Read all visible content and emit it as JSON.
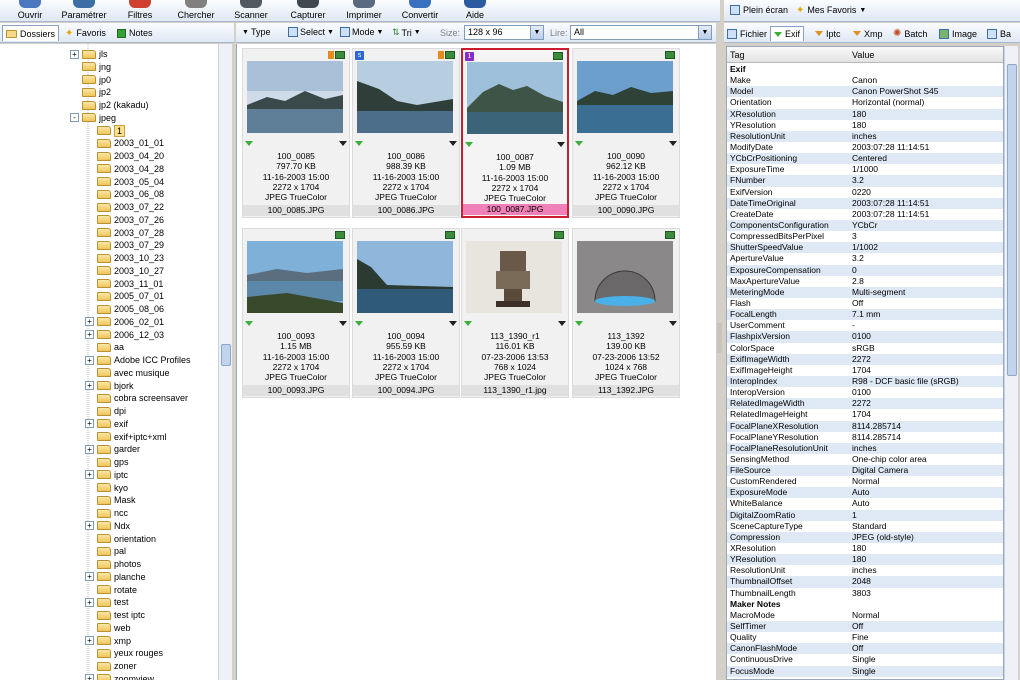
{
  "toolbar": {
    "items": [
      {
        "label": "Ouvrir",
        "icon": "open-icon",
        "color": "#4a78c0"
      },
      {
        "label": "Paramétrer",
        "icon": "settings-icon",
        "color": "#3a6ea5"
      },
      {
        "label": "Filtres",
        "icon": "filters-icon",
        "color": "#d04030"
      },
      {
        "label": "Chercher",
        "icon": "search-icon",
        "color": "#808080"
      },
      {
        "label": "Scanner",
        "icon": "scanner-icon",
        "color": "#505860"
      },
      {
        "label": "Capturer",
        "icon": "capture-icon",
        "color": "#404850"
      },
      {
        "label": "Imprimer",
        "icon": "print-icon",
        "color": "#5a6a80"
      },
      {
        "label": "Convertir",
        "icon": "convert-icon",
        "color": "#3a70c0"
      },
      {
        "label": "Aide",
        "icon": "help-icon",
        "color": "#2a5aa0"
      }
    ]
  },
  "right_toolbar": {
    "fullscreen_label": "Plein écran",
    "favorites_label": "Mes Favoris"
  },
  "left_tabs": {
    "folders": "Dossiers",
    "favorites": "Favoris",
    "notes": "Notes"
  },
  "tree": {
    "nodes": [
      {
        "label": "jls",
        "level": 1,
        "exp": "+"
      },
      {
        "label": "jng",
        "level": 1,
        "exp": ""
      },
      {
        "label": "jp0",
        "level": 1,
        "exp": ""
      },
      {
        "label": "jp2",
        "level": 1,
        "exp": ""
      },
      {
        "label": "jp2 (kakadu)",
        "level": 1,
        "exp": ""
      },
      {
        "label": "jpeg",
        "level": 1,
        "exp": "-"
      },
      {
        "label": "1",
        "level": 2,
        "exp": "",
        "selected": true
      },
      {
        "label": "2003_01_01",
        "level": 2,
        "exp": ""
      },
      {
        "label": "2003_04_20",
        "level": 2,
        "exp": ""
      },
      {
        "label": "2003_04_28",
        "level": 2,
        "exp": ""
      },
      {
        "label": "2003_05_04",
        "level": 2,
        "exp": ""
      },
      {
        "label": "2003_06_08",
        "level": 2,
        "exp": ""
      },
      {
        "label": "2003_07_22",
        "level": 2,
        "exp": ""
      },
      {
        "label": "2003_07_26",
        "level": 2,
        "exp": ""
      },
      {
        "label": "2003_07_28",
        "level": 2,
        "exp": ""
      },
      {
        "label": "2003_07_29",
        "level": 2,
        "exp": ""
      },
      {
        "label": "2003_10_23",
        "level": 2,
        "exp": ""
      },
      {
        "label": "2003_10_27",
        "level": 2,
        "exp": ""
      },
      {
        "label": "2003_11_01",
        "level": 2,
        "exp": ""
      },
      {
        "label": "2005_07_01",
        "level": 2,
        "exp": ""
      },
      {
        "label": "2005_08_06",
        "level": 2,
        "exp": ""
      },
      {
        "label": "2006_02_01",
        "level": 2,
        "exp": "+"
      },
      {
        "label": "2006_12_03",
        "level": 2,
        "exp": "+"
      },
      {
        "label": "aa",
        "level": 2,
        "exp": ""
      },
      {
        "label": "Adobe ICC Profiles",
        "level": 2,
        "exp": "+"
      },
      {
        "label": "avec musique",
        "level": 2,
        "exp": ""
      },
      {
        "label": "bjork",
        "level": 2,
        "exp": "+"
      },
      {
        "label": "cobra screensaver",
        "level": 2,
        "exp": ""
      },
      {
        "label": "dpi",
        "level": 2,
        "exp": ""
      },
      {
        "label": "exif",
        "level": 2,
        "exp": "+"
      },
      {
        "label": "exif+iptc+xml",
        "level": 2,
        "exp": ""
      },
      {
        "label": "garder",
        "level": 2,
        "exp": "+"
      },
      {
        "label": "gps",
        "level": 2,
        "exp": ""
      },
      {
        "label": "iptc",
        "level": 2,
        "exp": "+"
      },
      {
        "label": "kyo",
        "level": 2,
        "exp": ""
      },
      {
        "label": "Mask",
        "level": 2,
        "exp": ""
      },
      {
        "label": "ncc",
        "level": 2,
        "exp": ""
      },
      {
        "label": "Ndx",
        "level": 2,
        "exp": "+"
      },
      {
        "label": "orientation",
        "level": 2,
        "exp": ""
      },
      {
        "label": "pal",
        "level": 2,
        "exp": ""
      },
      {
        "label": "photos",
        "level": 2,
        "exp": ""
      },
      {
        "label": "planche",
        "level": 2,
        "exp": "+"
      },
      {
        "label": "rotate",
        "level": 2,
        "exp": ""
      },
      {
        "label": "test",
        "level": 2,
        "exp": "+"
      },
      {
        "label": "test iptc",
        "level": 2,
        "exp": ""
      },
      {
        "label": "web",
        "level": 2,
        "exp": ""
      },
      {
        "label": "xmp",
        "level": 2,
        "exp": "+"
      },
      {
        "label": "yeux rouges",
        "level": 2,
        "exp": ""
      },
      {
        "label": "zoner",
        "level": 2,
        "exp": ""
      },
      {
        "label": "zoomview",
        "level": 2,
        "exp": "+"
      }
    ]
  },
  "mid_toolbar": {
    "type_label": "Type",
    "select_label": "Select",
    "mode_label": "Mode",
    "sort_label": "Tri",
    "size_label": "Size:",
    "size_value": "128 x 96",
    "read_label": "Lire:",
    "read_value": "All"
  },
  "thumbnails": [
    {
      "name": "100_0085",
      "size": "797.70 KB",
      "date": "11-16-2003  15:00",
      "dims": "2272 x 1704",
      "format": "JPEG TrueColor",
      "file": "100_0085.JPG",
      "badge": "",
      "badge_color": "",
      "scene": "lake1"
    },
    {
      "name": "100_0086",
      "size": "988.39 KB",
      "date": "11-16-2003  15:00",
      "dims": "2272 x 1704",
      "format": "JPEG TrueColor",
      "file": "100_0086.JPG",
      "badge": "s",
      "badge_color": "#2a6ad0",
      "scene": "lake2"
    },
    {
      "name": "100_0087",
      "size": "1.09 MB",
      "date": "11-16-2003  15:00",
      "dims": "2272 x 1704",
      "format": "JPEG TrueColor",
      "file": "100_0087.JPG",
      "badge": "1",
      "badge_color": "#8a2ac8",
      "scene": "lake3",
      "selected": true
    },
    {
      "name": "100_0090",
      "size": "962.12 KB",
      "date": "11-16-2003  15:00",
      "dims": "2272 x 1704",
      "format": "JPEG TrueColor",
      "file": "100_0090.JPG",
      "badge": "",
      "badge_color": "",
      "scene": "lake4"
    },
    {
      "name": "100_0093",
      "size": "1.15 MB",
      "date": "11-16-2003  15:00",
      "dims": "2272 x 1704",
      "format": "JPEG TrueColor",
      "file": "100_0093.JPG",
      "badge": "",
      "badge_color": "",
      "scene": "lake5"
    },
    {
      "name": "100_0094",
      "size": "955.59 KB",
      "date": "11-16-2003  15:00",
      "dims": "2272 x 1704",
      "format": "JPEG TrueColor",
      "file": "100_0094.JPG",
      "badge": "",
      "badge_color": "",
      "scene": "lake6"
    },
    {
      "name": "113_1390_r1",
      "size": "116.01 KB",
      "date": "07-23-2006  13:53",
      "dims": "768 x 1024",
      "format": "JPEG TrueColor",
      "file": "113_1390_r1.jpg",
      "badge": "",
      "badge_color": "",
      "scene": "statue"
    },
    {
      "name": "113_1392",
      "size": "139.00 KB",
      "date": "07-23-2006  13:52",
      "dims": "1024 x 768",
      "format": "JPEG TrueColor",
      "file": "113_1392.JPG",
      "badge": "",
      "badge_color": "",
      "scene": "dome"
    }
  ],
  "exif_tabs": {
    "file": "Fichier",
    "exif": "Exif",
    "iptc": "Iptc",
    "xmp": "Xmp",
    "batch": "Batch",
    "image": "Image",
    "more": "Ba"
  },
  "exif_table": {
    "col_tag": "Tag",
    "col_value": "Value",
    "rows": [
      {
        "k": "Exif",
        "v": "",
        "group": true
      },
      {
        "k": "Make",
        "v": "Canon"
      },
      {
        "k": "Model",
        "v": "Canon PowerShot S45"
      },
      {
        "k": "Orientation",
        "v": "Horizontal (normal)"
      },
      {
        "k": "XResolution",
        "v": "180"
      },
      {
        "k": "YResolution",
        "v": "180"
      },
      {
        "k": "ResolutionUnit",
        "v": "inches"
      },
      {
        "k": "ModifyDate",
        "v": "2003:07:28 11:14:51"
      },
      {
        "k": "YCbCrPositioning",
        "v": "Centered"
      },
      {
        "k": "ExposureTime",
        "v": "1/1000"
      },
      {
        "k": "FNumber",
        "v": "3.2"
      },
      {
        "k": "ExifVersion",
        "v": "0220"
      },
      {
        "k": "DateTimeOriginal",
        "v": "2003:07:28 11:14:51"
      },
      {
        "k": "CreateDate",
        "v": "2003:07:28 11:14:51"
      },
      {
        "k": "ComponentsConfiguration",
        "v": "YCbCr"
      },
      {
        "k": "CompressedBitsPerPixel",
        "v": "3"
      },
      {
        "k": "ShutterSpeedValue",
        "v": "1/1002"
      },
      {
        "k": "ApertureValue",
        "v": "3.2"
      },
      {
        "k": "ExposureCompensation",
        "v": "0"
      },
      {
        "k": "MaxApertureValue",
        "v": "2.8"
      },
      {
        "k": "MeteringMode",
        "v": "Multi-segment"
      },
      {
        "k": "Flash",
        "v": "Off"
      },
      {
        "k": "FocalLength",
        "v": "7.1 mm"
      },
      {
        "k": "UserComment",
        "v": "-"
      },
      {
        "k": "FlashpixVersion",
        "v": "0100"
      },
      {
        "k": "ColorSpace",
        "v": "sRGB"
      },
      {
        "k": "ExifImageWidth",
        "v": "2272"
      },
      {
        "k": "ExifImageHeight",
        "v": "1704"
      },
      {
        "k": "InteropIndex",
        "v": "R98 - DCF basic file (sRGB)"
      },
      {
        "k": "InteropVersion",
        "v": "0100"
      },
      {
        "k": "RelatedImageWidth",
        "v": "2272"
      },
      {
        "k": "RelatedImageHeight",
        "v": "1704"
      },
      {
        "k": "FocalPlaneXResolution",
        "v": "8114.285714"
      },
      {
        "k": "FocalPlaneYResolution",
        "v": "8114.285714"
      },
      {
        "k": "FocalPlaneResolutionUnit",
        "v": "inches"
      },
      {
        "k": "SensingMethod",
        "v": "One-chip color area"
      },
      {
        "k": "FileSource",
        "v": "Digital Camera"
      },
      {
        "k": "CustomRendered",
        "v": "Normal"
      },
      {
        "k": "ExposureMode",
        "v": "Auto"
      },
      {
        "k": "WhiteBalance",
        "v": "Auto"
      },
      {
        "k": "DigitalZoomRatio",
        "v": "1"
      },
      {
        "k": "SceneCaptureType",
        "v": "Standard"
      },
      {
        "k": "Compression",
        "v": "JPEG (old-style)"
      },
      {
        "k": "XResolution",
        "v": "180"
      },
      {
        "k": "YResolution",
        "v": "180"
      },
      {
        "k": "ResolutionUnit",
        "v": "inches"
      },
      {
        "k": "ThumbnailOffset",
        "v": "2048"
      },
      {
        "k": "ThumbnailLength",
        "v": "3803"
      },
      {
        "k": "Maker Notes",
        "v": "",
        "group": true
      },
      {
        "k": "MacroMode",
        "v": "Normal"
      },
      {
        "k": "SelfTimer",
        "v": "Off"
      },
      {
        "k": "Quality",
        "v": "Fine"
      },
      {
        "k": "CanonFlashMode",
        "v": "Off"
      },
      {
        "k": "ContinuousDrive",
        "v": "Single"
      },
      {
        "k": "FocusMode",
        "v": "Single"
      }
    ]
  }
}
